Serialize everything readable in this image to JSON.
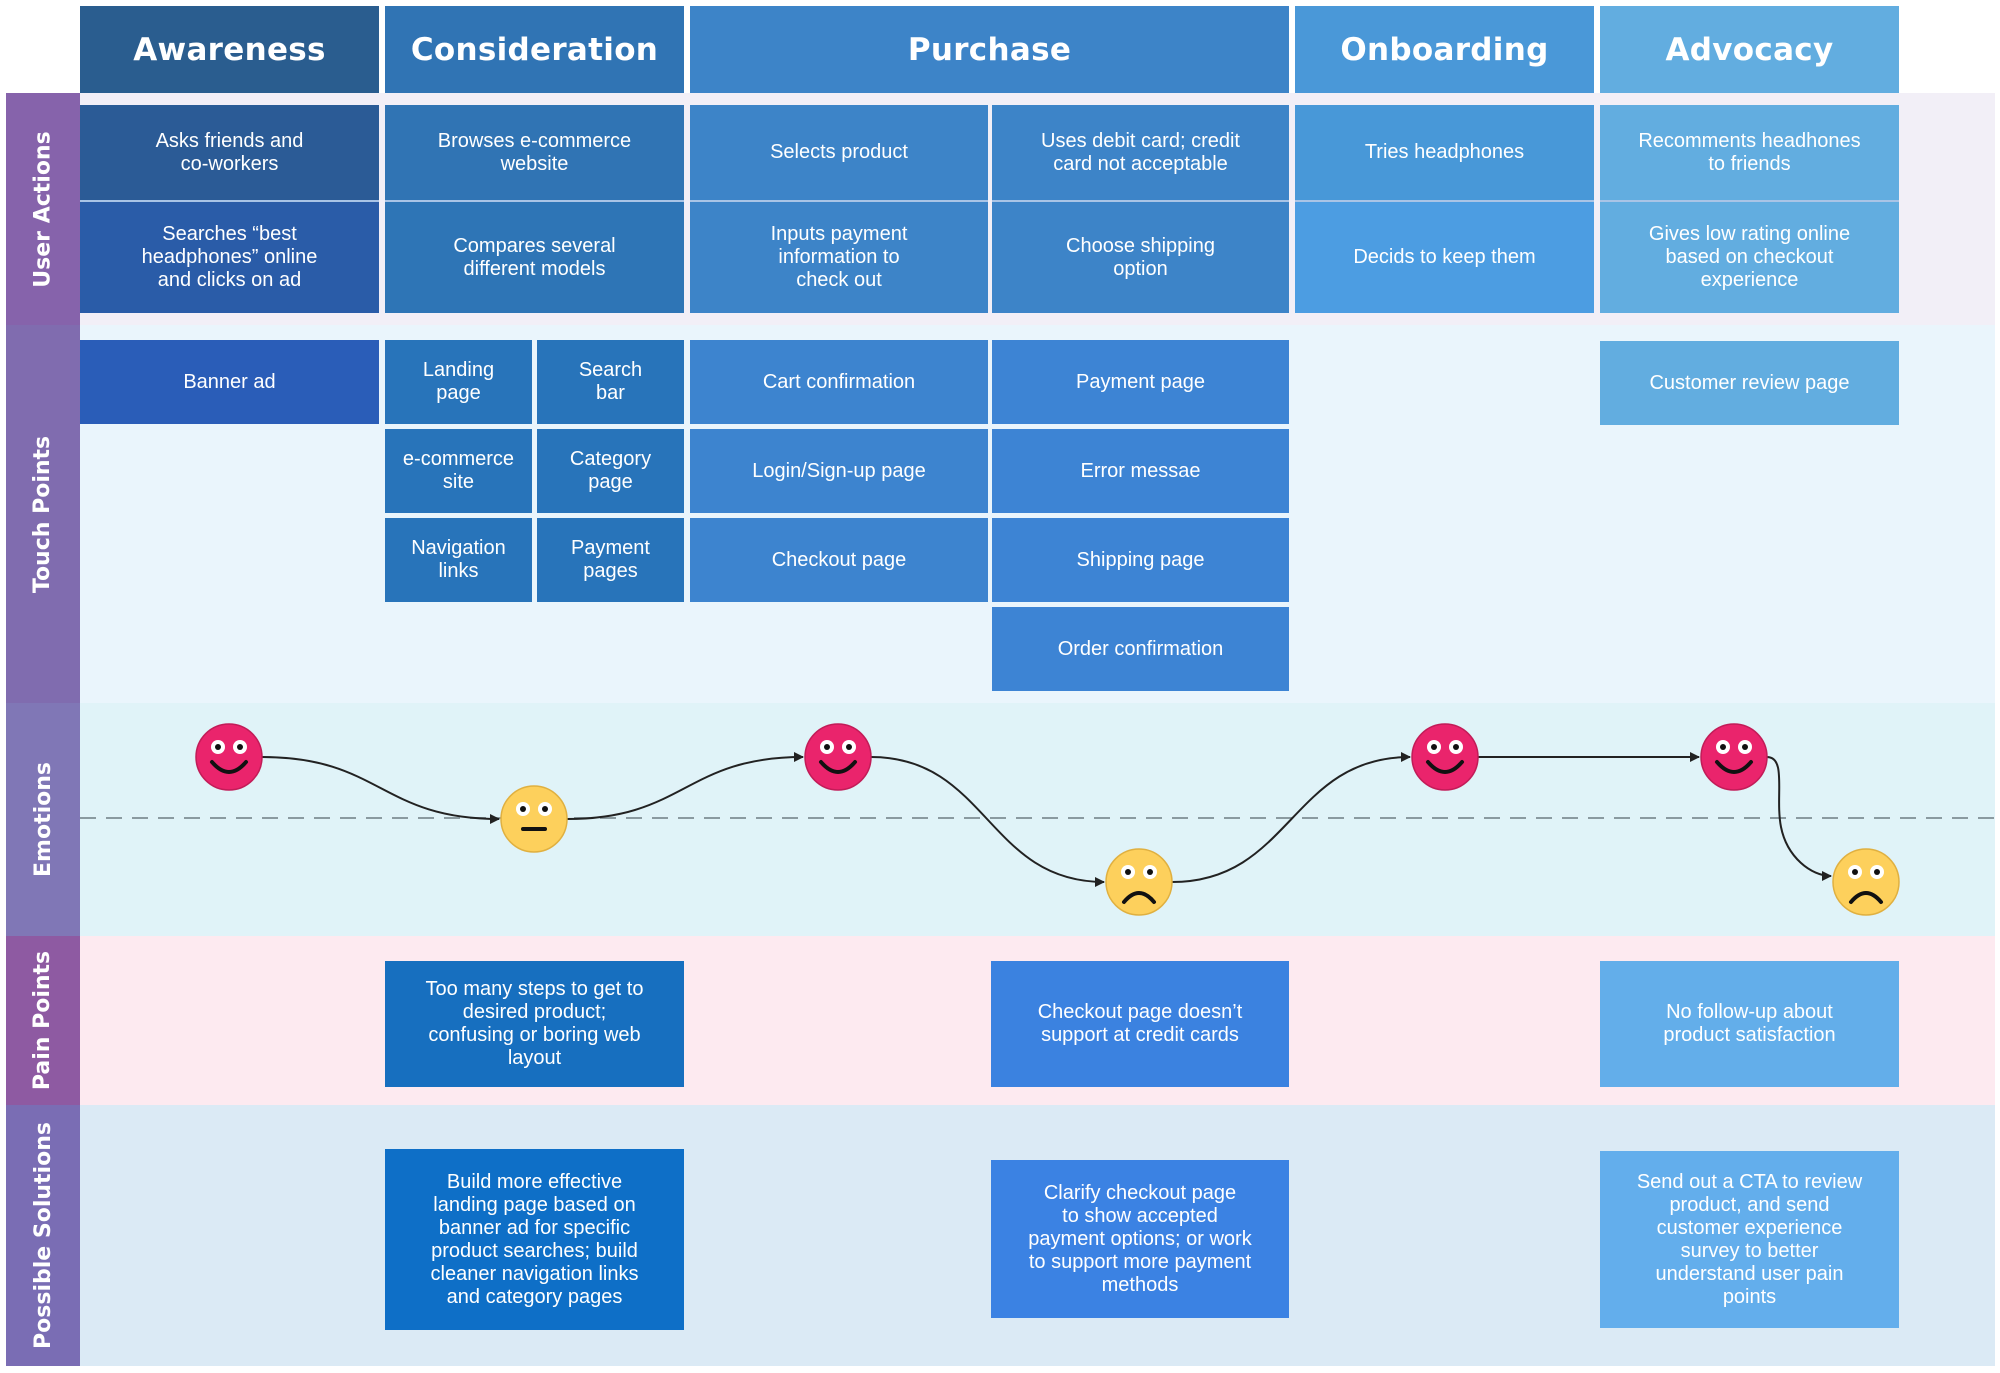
{
  "stages": [
    {
      "label": "Awareness",
      "color": "#2a5d8f"
    },
    {
      "label": "Consideration",
      "color": "#3074b4"
    },
    {
      "label": "Purchase",
      "color": "#3d84c8"
    },
    {
      "label": "Onboarding",
      "color": "#4a98d8"
    },
    {
      "label": "Advocacy",
      "color": "#62ade0"
    }
  ],
  "lanes": {
    "user_actions": {
      "label": "User Actions",
      "label_color": "#8663ab",
      "bg": "#f2eff7"
    },
    "touch_points": {
      "label": "Touch Points",
      "label_color": "#806caf",
      "bg": "#eaf5fc"
    },
    "emotions": {
      "label": "Emotions",
      "label_color": "#8077b6",
      "bg": "#e0f3f8"
    },
    "pain_points": {
      "label": "Pain Points",
      "label_color": "#8e5aa2",
      "bg": "#fdeaf0"
    },
    "solutions": {
      "label": "Possible Solutions",
      "label_color": "#7a6db4",
      "bg": "#dbeaf5"
    }
  },
  "user_actions": {
    "awareness": [
      "Asks friends and\nco-workers",
      "Searches “best\nheadphones” online\nand clicks on ad"
    ],
    "consideration": [
      "Browses e-commerce\nwebsite",
      "Compares several\ndifferent models"
    ],
    "purchase_a": [
      "Selects product",
      "Inputs payment\ninformation to\ncheck out"
    ],
    "purchase_b": [
      "Uses debit card; credit\ncard not acceptable",
      "Choose shipping\noption"
    ],
    "onboarding": [
      "Tries headphones",
      "Decids to keep them"
    ],
    "advocacy": [
      "Recomments headhones\nto friends",
      "Gives low rating online\nbased on checkout\nexperience"
    ]
  },
  "touch_points": {
    "awareness": [
      "Banner ad"
    ],
    "consideration_a": [
      "Landing\npage",
      "e-commerce\nsite",
      "Navigation\nlinks"
    ],
    "consideration_b": [
      "Search\nbar",
      "Category\npage",
      "Payment\npages"
    ],
    "purchase_a": [
      "Cart confirmation",
      "Login/Sign-up page",
      "Checkout page"
    ],
    "purchase_b": [
      "Payment page",
      "Error messae",
      "Shipping page",
      "Order confirmation"
    ],
    "advocacy": [
      "Customer review page"
    ]
  },
  "emotions": [
    {
      "stage": "Awareness",
      "mood": "happy"
    },
    {
      "stage": "Consideration",
      "mood": "neutral"
    },
    {
      "stage": "Purchase",
      "mood": "happy"
    },
    {
      "stage": "Purchase",
      "mood": "sad"
    },
    {
      "stage": "Onboarding",
      "mood": "happy"
    },
    {
      "stage": "Advocacy",
      "mood": "happy"
    },
    {
      "stage": "Advocacy",
      "mood": "sad"
    }
  ],
  "mood_colors": {
    "happy": "#ea246c",
    "neutral": "#fdd05c",
    "sad": "#fdd05c"
  },
  "pain_points": {
    "consideration": "Too many steps to get to\ndesired product;\nconfusing or boring web\nlayout",
    "purchase": "Checkout page doesn’t\nsupport at credit cards",
    "advocacy": "No follow-up about\nproduct satisfaction"
  },
  "solutions": {
    "consideration": "Build more effective\nlanding page based on\nbanner ad for specific\nproduct searches; build\ncleaner navigation links\nand category pages",
    "purchase": "Clarify checkout page\nto show accepted\npayment options; or work\nto support more payment\nmethods",
    "advocacy": "Send out a CTA to review\nproduct, and send\ncustomer experience\nsurvey to better\nunderstand user pain\npoints"
  }
}
